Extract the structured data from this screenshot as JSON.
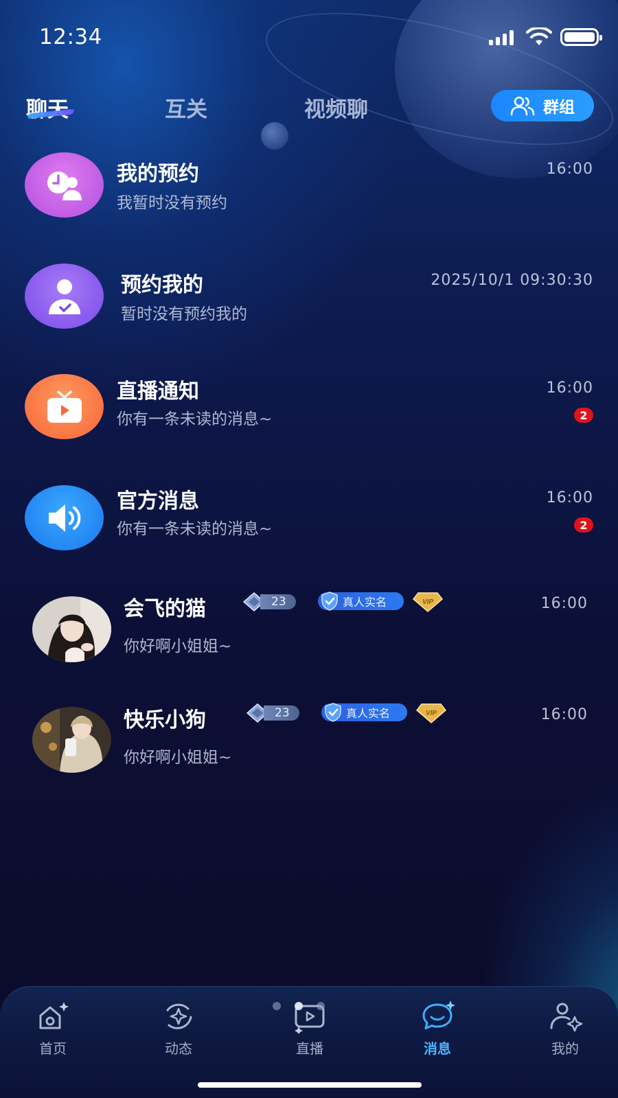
{
  "status_bar": {
    "time": "12:34"
  },
  "tabs": [
    {
      "label": "聊天",
      "active": true
    },
    {
      "label": "互关",
      "active": false
    },
    {
      "label": "视频聊",
      "active": false
    }
  ],
  "group_button": {
    "label": "群组",
    "icon": "users-icon"
  },
  "conversations": [
    {
      "title": "我的预约",
      "subtitle": "我暂时没有预约",
      "time": "16:00",
      "icon": "clock-user-icon",
      "color": "#c05fe6"
    },
    {
      "title": "预约我的",
      "subtitle": "暂时没有预约我的",
      "time": "2025/10/1 09:30:30",
      "icon": "user-check-icon",
      "color": "#8b5cf0"
    },
    {
      "title": "直播通知",
      "subtitle": "你有一条未读的消息~",
      "time": "16:00",
      "badge": "2",
      "icon": "tv-play-icon",
      "color": "#ff7a45"
    },
    {
      "title": "官方消息",
      "subtitle": "你有一条未读的消息~",
      "time": "16:00",
      "badge": "2",
      "icon": "speaker-icon",
      "color": "#2a8cf5"
    }
  ],
  "chats": [
    {
      "name": "会飞的猫",
      "message": "你好啊小姐姐~",
      "time": "16:00",
      "level": "23",
      "verified_label": "真人实名",
      "vip_label": "VIP"
    },
    {
      "name": "快乐小狗",
      "message": "你好啊小姐姐~",
      "time": "16:00",
      "level": "23",
      "verified_label": "真人实名",
      "vip_label": "VIP"
    }
  ],
  "bottom_nav": [
    {
      "label": "首页",
      "icon": "home-icon",
      "active": false
    },
    {
      "label": "动态",
      "icon": "moments-icon",
      "active": false
    },
    {
      "label": "直播",
      "icon": "live-icon",
      "active": false
    },
    {
      "label": "消息",
      "icon": "message-icon",
      "active": true
    },
    {
      "label": "我的",
      "icon": "profile-icon",
      "active": false
    }
  ],
  "colors": {
    "accent": "#2a9dff",
    "badge": "#e0121c",
    "active_nav": "#49b7ff"
  }
}
